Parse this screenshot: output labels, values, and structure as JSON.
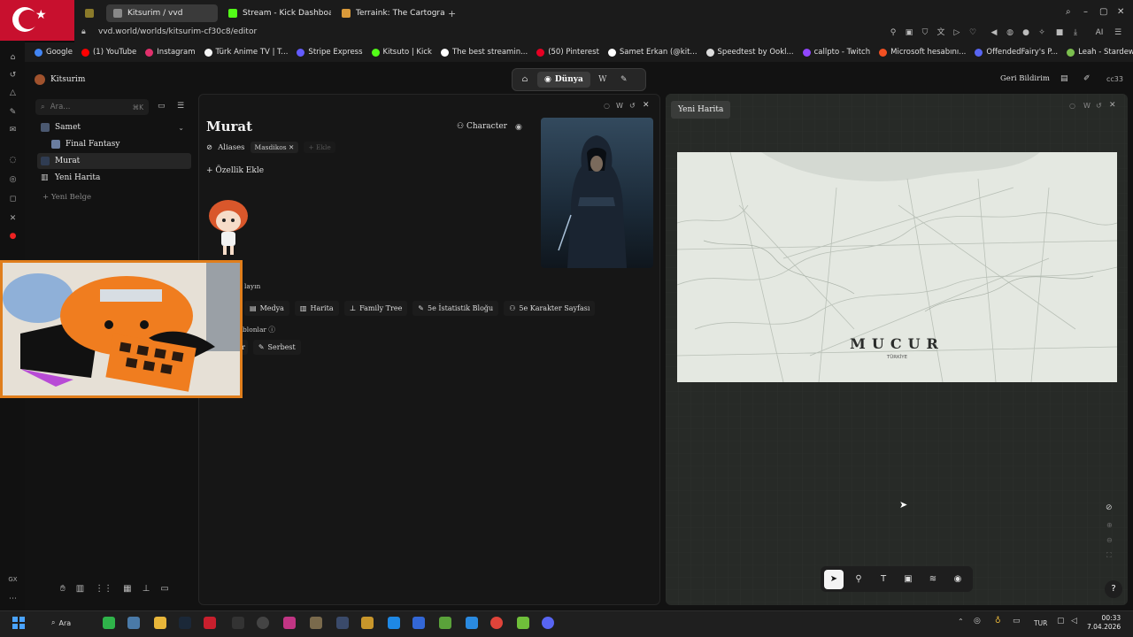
{
  "browser": {
    "tabs": [
      {
        "label": "Kitsurim / vvd",
        "active": true
      },
      {
        "label": "Stream - Kick Dashboard",
        "active": false
      },
      {
        "label": "Terraink: The Cartographic",
        "active": false
      }
    ],
    "url": "vvd.world/worlds/kitsurim-cf30c8/editor",
    "bookmarks": [
      {
        "label": "Google",
        "color": "#4285f4"
      },
      {
        "label": "(1) YouTube",
        "color": "#ff0000"
      },
      {
        "label": "Instagram",
        "color": "#e1306c"
      },
      {
        "label": "Türk Anime TV | T...",
        "color": "#f5f5f5"
      },
      {
        "label": "Stripe Express",
        "color": "#635bff"
      },
      {
        "label": "Kitsuto | Kick",
        "color": "#53fc18"
      },
      {
        "label": "The best streamin...",
        "color": "#ffffff"
      },
      {
        "label": "(50) Pinterest",
        "color": "#e60023"
      },
      {
        "label": "Samet Erkan (@kit...",
        "color": "#ffffff"
      },
      {
        "label": "Speedtest by Ookl...",
        "color": "#ffffff"
      },
      {
        "label": "callpto - Twitch",
        "color": "#9146ff"
      },
      {
        "label": "Microsoft hesabını...",
        "color": "#f25022"
      },
      {
        "label": "OffendedFairy's P...",
        "color": "#5865f2"
      },
      {
        "label": "Leah - Stardew Va...",
        "color": "#7bbf4e"
      }
    ]
  },
  "app": {
    "workspace": "Kitsurim",
    "nav": {
      "active_label": "Dünya"
    },
    "feedback_label": "Geri Bildirim",
    "user": "cc33",
    "search_placeholder": "Ara...",
    "search_shortcut": "⌘K",
    "tree": [
      {
        "label": "Samet",
        "selected": false
      },
      {
        "label": "Final Fantasy",
        "selected": false
      },
      {
        "label": "Murat",
        "selected": true
      },
      {
        "label": "Yeni Harita",
        "selected": false
      }
    ],
    "new_doc_label": "Yeni Belge"
  },
  "document": {
    "title": "Murat",
    "aliases_label": "Aliases",
    "alias": "Masdikos",
    "alias_add": "Ekle",
    "add_property": "Özellik Ekle",
    "type_label": "Character",
    "partial_label_1": "layın",
    "partial_label_2": "blonlar",
    "templates": [
      {
        "label": "Medya",
        "icon": "media-icon"
      },
      {
        "label": "Harita",
        "icon": "map-icon"
      },
      {
        "label": "Family Tree",
        "icon": "tree-icon"
      },
      {
        "label": "5e İstatistik Bloğu",
        "icon": "pen-icon"
      },
      {
        "label": "5e Karakter Sayfası",
        "icon": "person-icon"
      }
    ],
    "templates_row2": [
      {
        "label": "r"
      },
      {
        "label": "Serbest",
        "icon": "pen-icon"
      }
    ]
  },
  "map": {
    "tab_label": "Yeni Harita",
    "name": "MUCUR",
    "subtitle": "TÜRKİYE",
    "tools": [
      "select-icon",
      "pin-icon",
      "text-icon",
      "image-icon",
      "layers-icon",
      "eye-icon"
    ],
    "help": "?"
  },
  "taskbar": {
    "search_label": "Ara",
    "language": "TUR",
    "time": "00:33",
    "date": "7.04.2026"
  }
}
